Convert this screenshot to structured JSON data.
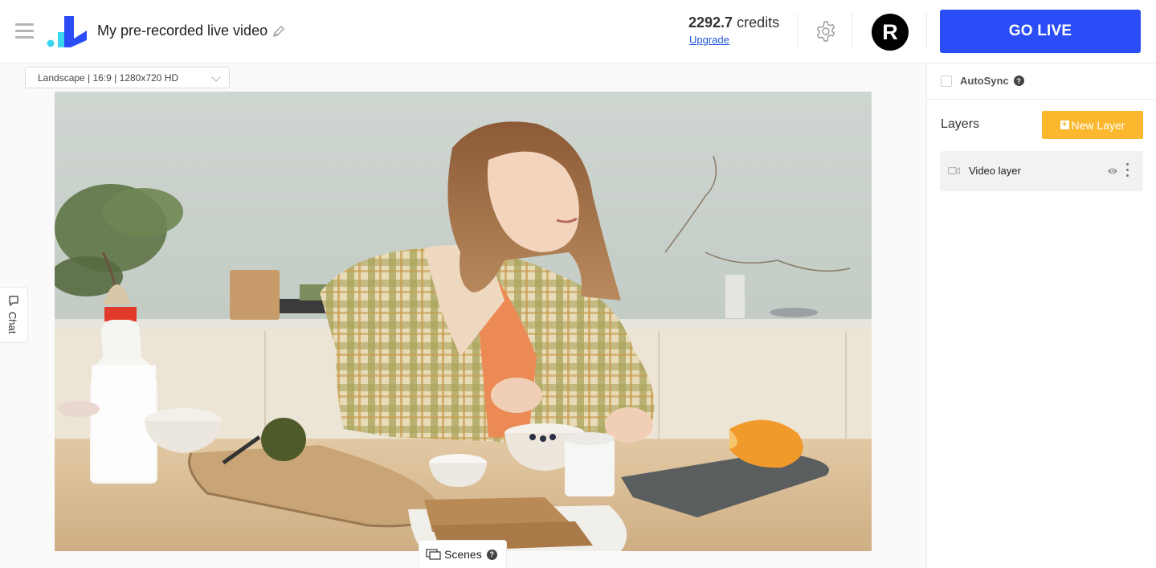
{
  "header": {
    "title": "My pre-recorded live video",
    "credits_value": "2292.7",
    "credits_unit": "credits",
    "upgrade_label": "Upgrade",
    "avatar_initial": "R",
    "go_live_label": "GO LIVE"
  },
  "stage": {
    "resolution_selected": "Landscape | 16:9 | 1280x720 HD",
    "chat_label": "Chat",
    "scenes_label": "Scenes",
    "help_glyph": "?"
  },
  "panel": {
    "autosync_label": "AutoSync",
    "autosync_checked": false,
    "help_glyph": "?",
    "layers_title": "Layers",
    "new_layer_label": "New Layer",
    "layers": [
      {
        "label": "Video layer",
        "icon": "video-camera-icon",
        "visible": true
      }
    ]
  },
  "colors": {
    "primary": "#2b4df7",
    "accent": "#fbb82e",
    "link": "#2255dd"
  }
}
